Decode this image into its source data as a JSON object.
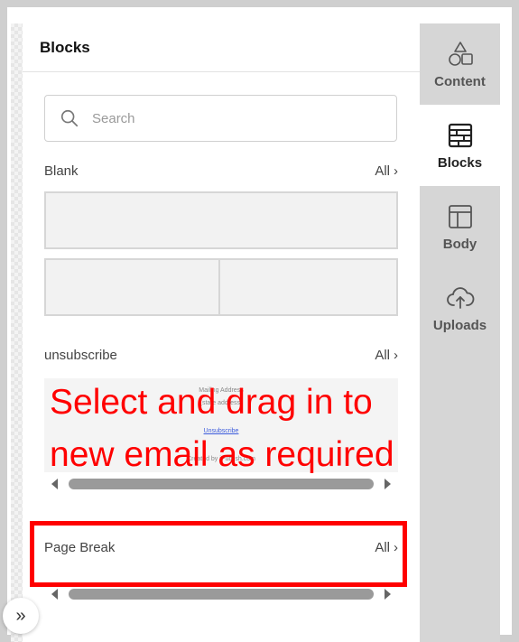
{
  "panel": {
    "title": "Blocks"
  },
  "search": {
    "placeholder": "Search",
    "icon": "search-icon"
  },
  "sections": {
    "blank": {
      "label": "Blank",
      "all_label": "All"
    },
    "unsubscribe": {
      "label": "unsubscribe",
      "all_label": "All",
      "preview": {
        "line1": "Mailing Address",
        "line2": "(state address)",
        "link": "Unsubscribe",
        "footer": "Created by iPublish.com"
      }
    },
    "page_break": {
      "label": "Page Break",
      "all_label": "All"
    }
  },
  "tabs": [
    {
      "label": "Content",
      "icon": "shapes-icon",
      "active": false
    },
    {
      "label": "Blocks",
      "icon": "blocks-icon",
      "active": true
    },
    {
      "label": "Body",
      "icon": "layout-icon",
      "active": false
    },
    {
      "label": "Uploads",
      "icon": "cloud-upload-icon",
      "active": false
    }
  ],
  "annotation": {
    "line1": "Select and drag in to",
    "line2": "new email as required",
    "color": "#ff0000"
  },
  "expand": {
    "icon": "double-chevron-right-icon",
    "glyph": "»"
  }
}
